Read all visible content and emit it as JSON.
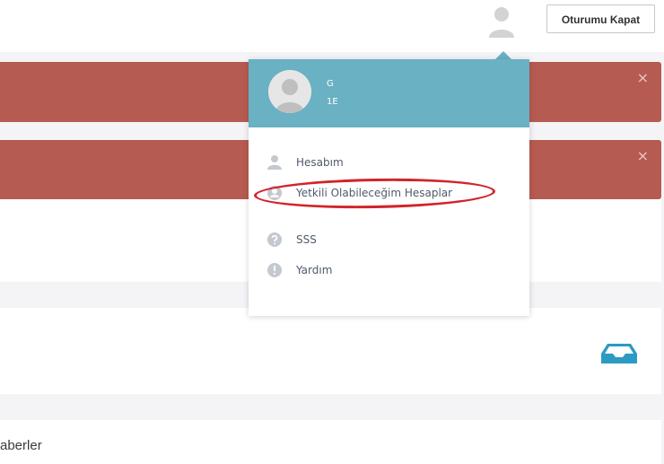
{
  "header": {
    "logout_label": "Oturumu Kapat"
  },
  "alerts": [
    {
      "close_glyph": "×"
    },
    {
      "close_glyph": "×"
    }
  ],
  "news_section": {
    "label_fragment": "aberler"
  },
  "user_menu": {
    "name": "G",
    "id": "1E",
    "items": [
      {
        "label": "Hesabım",
        "icon": "user-icon"
      },
      {
        "label": "Yetkili Olabileceğim Hesaplar",
        "icon": "user-circle-icon"
      },
      {
        "label": "SSS",
        "icon": "question-circle-icon"
      },
      {
        "label": "Yardım",
        "icon": "exclamation-circle-icon"
      }
    ]
  },
  "colors": {
    "header_accent": "#69b1c3",
    "alert_red": "#b65b51",
    "highlight_red": "#d2242a",
    "inbox_icon": "#2b9bc4"
  }
}
